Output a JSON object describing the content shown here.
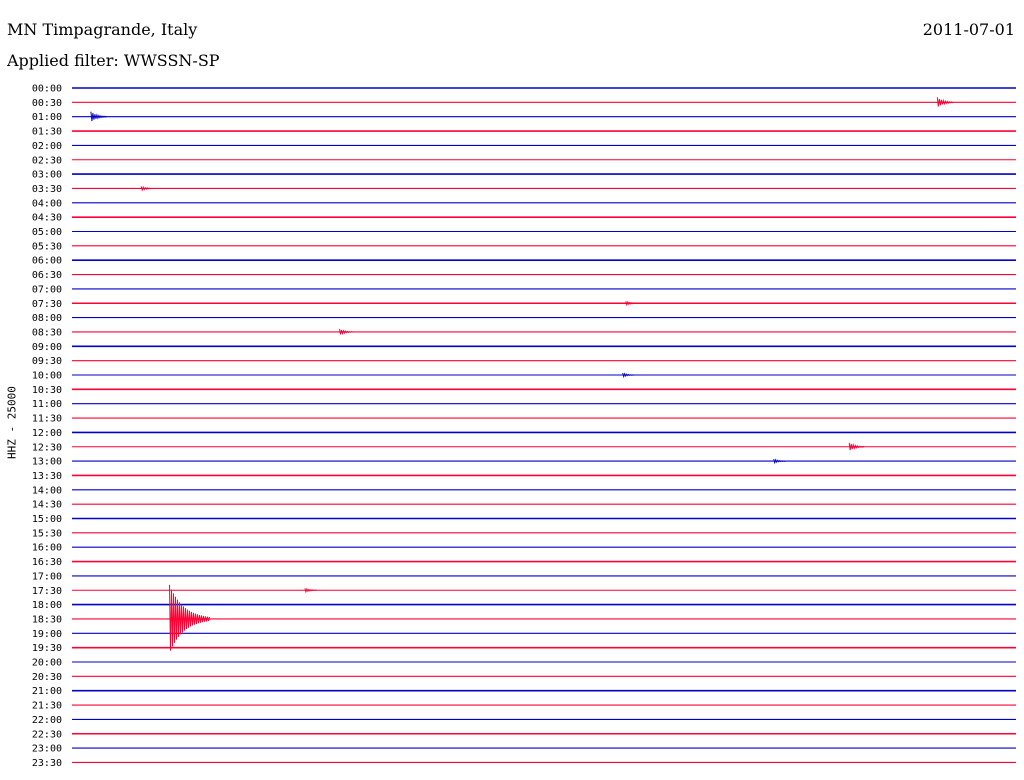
{
  "header": {
    "station": "MN Timpagrande, Italy",
    "date": "2011-07-01",
    "filter": "Applied filter: WWSSN-SP"
  },
  "colors": {
    "even_rows": "#0000c8",
    "odd_rows": "#ff0033"
  },
  "chart_data": {
    "type": "line",
    "title": "MN Timpagrande, Italy",
    "ylabel": "HHZ - 25000",
    "categories": [
      "00:00",
      "00:30",
      "01:00",
      "01:30",
      "02:00",
      "02:30",
      "03:00",
      "03:30",
      "04:00",
      "04:30",
      "05:00",
      "05:30",
      "06:00",
      "06:30",
      "07:00",
      "07:30",
      "08:00",
      "08:30",
      "09:00",
      "09:30",
      "10:00",
      "10:30",
      "11:00",
      "11:30",
      "12:00",
      "12:30",
      "13:00",
      "13:30",
      "14:00",
      "14:30",
      "15:00",
      "15:30",
      "16:00",
      "16:30",
      "17:00",
      "17:30",
      "18:00",
      "18:30",
      "19:00",
      "19:30",
      "20:00",
      "20:30",
      "21:00",
      "21:30",
      "22:00",
      "22:30",
      "23:00",
      "23:30"
    ],
    "trace_duration_min": 30,
    "events": [
      {
        "row": "00:30",
        "minute": 27.5,
        "amplitude": 5
      },
      {
        "row": "01:00",
        "minute": 0.6,
        "amplitude": 5
      },
      {
        "row": "03:30",
        "minute": 2.2,
        "amplitude": 2
      },
      {
        "row": "07:30",
        "minute": 17.6,
        "amplitude": 2
      },
      {
        "row": "08:30",
        "minute": 8.5,
        "amplitude": 3
      },
      {
        "row": "10:00",
        "minute": 17.5,
        "amplitude": 2
      },
      {
        "row": "12:30",
        "minute": 24.7,
        "amplitude": 4
      },
      {
        "row": "13:00",
        "minute": 22.3,
        "amplitude": 2
      },
      {
        "row": "17:30",
        "minute": 7.4,
        "amplitude": 2
      },
      {
        "row": "18:30",
        "minute": 3.1,
        "amplitude": 34
      }
    ]
  }
}
